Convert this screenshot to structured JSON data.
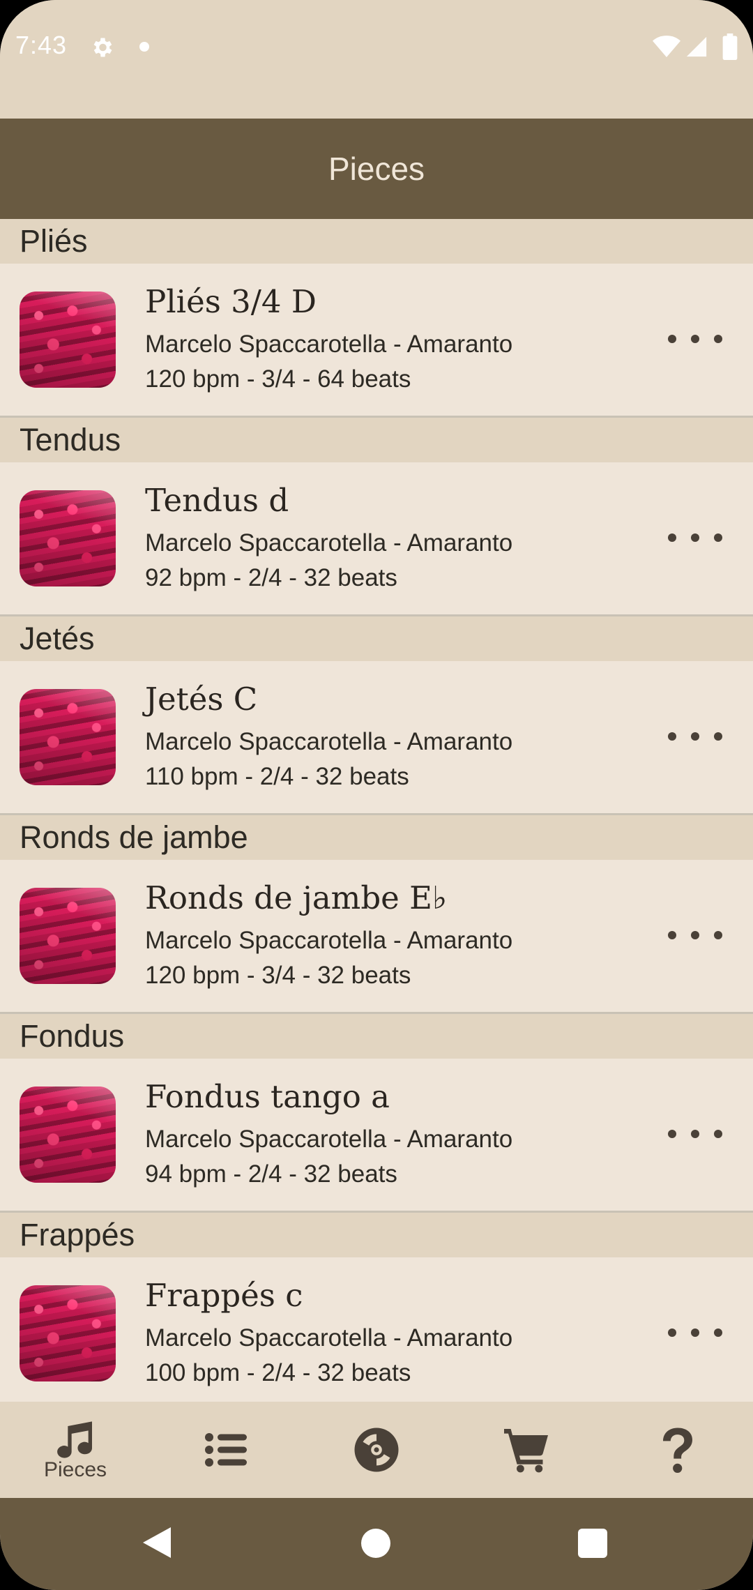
{
  "status_bar": {
    "time": "7:43",
    "icons": [
      "gear-icon",
      "notification-dot-icon",
      "wifi-icon",
      "signal-icon",
      "battery-icon"
    ]
  },
  "app_bar": {
    "title": "Pieces"
  },
  "sections": [
    {
      "header": "Pliés",
      "item": {
        "title": "Pliés 3/4 D",
        "artist": "Marcelo Spaccarotella - Amaranto",
        "meta": "120 bpm - 3/4 - 64 beats"
      }
    },
    {
      "header": "Tendus",
      "item": {
        "title": "Tendus d",
        "artist": "Marcelo Spaccarotella - Amaranto",
        "meta": "92 bpm - 2/4 - 32 beats"
      }
    },
    {
      "header": "Jetés",
      "item": {
        "title": "Jetés C",
        "artist": "Marcelo Spaccarotella - Amaranto",
        "meta": "110 bpm - 2/4 - 32 beats"
      }
    },
    {
      "header": "Ronds de jambe",
      "item": {
        "title": "Ronds de jambe E♭",
        "artist": "Marcelo Spaccarotella - Amaranto",
        "meta": "120 bpm - 3/4 - 32 beats"
      }
    },
    {
      "header": "Fondus",
      "item": {
        "title": "Fondus tango a",
        "artist": "Marcelo Spaccarotella - Amaranto",
        "meta": "94 bpm - 2/4 - 32 beats"
      }
    },
    {
      "header": "Frappés",
      "item": {
        "title": "Frappés c",
        "artist": "Marcelo Spaccarotella - Amaranto",
        "meta": "100 bpm - 2/4 - 32 beats"
      }
    }
  ],
  "bottom_nav": {
    "items": [
      {
        "label": "Pieces",
        "icon": "music-note-icon",
        "selected": true
      },
      {
        "label": "",
        "icon": "list-icon",
        "selected": false
      },
      {
        "label": "",
        "icon": "disc-icon",
        "selected": false
      },
      {
        "label": "",
        "icon": "cart-icon",
        "selected": false
      },
      {
        "label": "",
        "icon": "help-icon",
        "selected": false
      }
    ]
  },
  "colors": {
    "background": "#e2d5c1",
    "app_bar": "#695a41",
    "row": "#efe5d9",
    "text": "#2d2a24",
    "accent_thumbnail": "#c2184f"
  }
}
